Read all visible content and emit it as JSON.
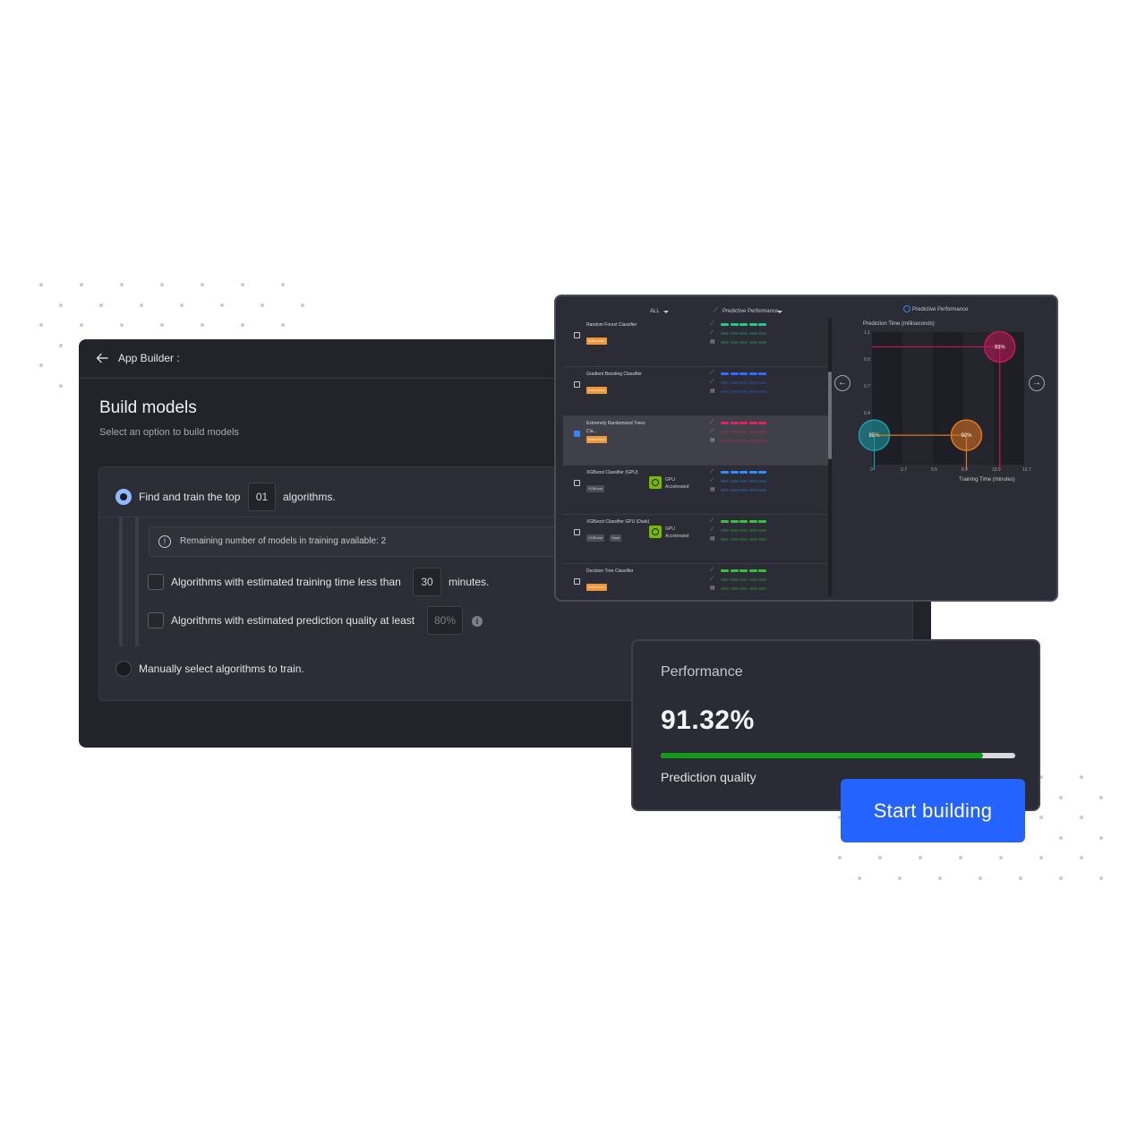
{
  "builder": {
    "app_title": "App Builder :",
    "page_title": "Build models",
    "page_subtitle": "Select an option to build models",
    "option_top": {
      "prefix": "Find and train the top",
      "count": "01",
      "suffix": "algorithms."
    },
    "info_text": "Remaining number of models in training available:  2",
    "time_filter": {
      "label": "Algorithms with estimated training time less than",
      "value": "30",
      "unit": "minutes."
    },
    "quality_filter": {
      "label": "Algorithms with estimated prediction quality at least",
      "placeholder": "80%"
    },
    "option_manual": "Manually select algorithms to train."
  },
  "model_list": {
    "filter_label": "ALL",
    "sort_label": "Predictive Performance",
    "rows": [
      {
        "name": "Random Forest Classifier",
        "tags": [
          "scikit-learn"
        ],
        "color": "#1fc98a",
        "checked": false,
        "selected": false
      },
      {
        "name": "Gradient Boosting Classifier",
        "tags": [
          "scikit-learn"
        ],
        "color": "#2f6bff",
        "checked": false,
        "selected": false
      },
      {
        "name": "Extremely Randomized Trees Cla...",
        "tags": [
          "scikit-learn"
        ],
        "color": "#e0245e",
        "checked": true,
        "selected": true
      },
      {
        "name": "XGBoost Classifier (GPU)",
        "tags": [
          "XGBoost"
        ],
        "color": "#2d8cff",
        "checked": false,
        "selected": false,
        "gpu": "GPU Accelerated"
      },
      {
        "name": "XGBoost Classifier GPU (Dask)",
        "tags": [
          "XGBoost",
          "Dask"
        ],
        "color": "#35c23a",
        "checked": false,
        "selected": false,
        "gpu": "GPU Accelerated"
      },
      {
        "name": "Decision Tree Classifier",
        "tags": [
          "scikit-learn"
        ],
        "color": "#35c23a",
        "checked": false,
        "selected": false
      }
    ]
  },
  "chart_data": {
    "type": "scatter",
    "title": "Predictive Performance",
    "ylabel": "Prediction Time (milliseconds)",
    "xlabel": "Training Time (minutes)",
    "x_ticks": [
      "0",
      "2.7",
      "5.5",
      "8.2",
      "10.9",
      "13.7"
    ],
    "y_ticks": [
      "1.1",
      "0.9",
      "0.7",
      "0.4"
    ],
    "xlim": [
      0,
      13.7
    ],
    "ylim": [
      0.2,
      1.1
    ],
    "points": [
      {
        "label": "93%",
        "x": 11.5,
        "y": 1.0,
        "color": "#c2185b"
      },
      {
        "label": "85%",
        "x": 0.2,
        "y": 0.4,
        "color": "#1a9fa8"
      },
      {
        "label": "92%",
        "x": 8.5,
        "y": 0.4,
        "color": "#e0761f"
      }
    ]
  },
  "performance": {
    "label": "Performance",
    "value": "91.32%",
    "fraction": 0.91,
    "sublabel": "Prediction quality"
  },
  "cta": {
    "label": "Start building"
  }
}
